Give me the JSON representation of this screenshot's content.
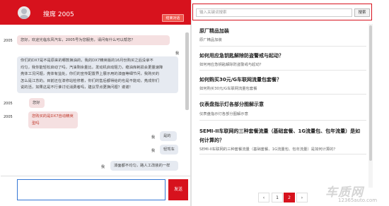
{
  "chat_header": {
    "title": "搜席 2005",
    "end_button": "结束对话"
  },
  "messages": [
    {
      "role": "agent",
      "speaker": "2005",
      "lines": [
        "您好，欢迎光临东风汽车，2005号为您服务，请问有什么可以帮您？"
      ]
    },
    {
      "role": "user",
      "speaker": "我",
      "lines": [
        "你们的DX7是不是原来的哪款换油的，我的DX7精英版的16月份购买之后没拿不",
        "均匀，我你能轻松启动了吗，汽油剩余量比，发动机启动阻力，稳油库耗损会更量速降",
        "亮体工况问题，亮体有益处。你们的宣传配置界上展示用的漆面等细节问，我购买的",
        "怎么是江苏的。目前还在漆修站检修着，你们的售后都得给的也是不能动，亮成你们",
        "说的活，如果这是不行谁讨论消费者吗，建议早点更换问题？谢谢！"
      ]
    },
    {
      "role": "agent",
      "speaker": "2005",
      "lines": [
        "您好"
      ]
    },
    {
      "role": "agent",
      "speaker": "2005",
      "lines": [
        "您购买的是DX7自动精英型吗"
      ],
      "red": true
    },
    {
      "role": "user",
      "speaker": "我",
      "lines": [
        "是的"
      ]
    },
    {
      "role": "user",
      "speaker": "我",
      "lines": [
        "轻驾车"
      ]
    },
    {
      "role": "user",
      "speaker": "我",
      "lines": [
        "漆面都不均匀，路人工改装的一样"
      ]
    }
  ],
  "compose": {
    "send_label": "发送",
    "input_value": ""
  },
  "search": {
    "placeholder": "输入关键词搜索",
    "button_label": "搜索"
  },
  "results": [
    {
      "title": "原厂精品加装",
      "desc": "原厂精品加装"
    },
    {
      "title": "如何用应急钥匙解除防盗警戒与起动？",
      "desc": "如何用应急钥匙解除防盗警戒与起动？"
    },
    {
      "title": "如何购买30元/G车联网流量包套餐？",
      "desc": "如何购买30元/G车联网流量包套餐"
    },
    {
      "title": "仪表盘指示灯各部分图解示意",
      "desc": "仪表盘指示灯各部分图解示意"
    },
    {
      "title": "SEMI-II车联网的三种套餐流量（基础套餐、1G流量包、包年流量）是如",
      "title2": "何计算的？",
      "desc": "SEMI-II车联网的三种套餐流量（基础套餐、1G流量包、包年流量）是如何计算的？"
    }
  ],
  "pagination": {
    "prev": "‹",
    "pages": [
      "1",
      "2"
    ],
    "active_page": "2",
    "next": "›"
  },
  "watermark": {
    "logo_text": "车质网",
    "url": "12365auto.com"
  },
  "colors": {
    "brand_red": "#d7121d",
    "agent_bubble": "#f5e0e1",
    "user_bubble": "#e6eaf1"
  }
}
